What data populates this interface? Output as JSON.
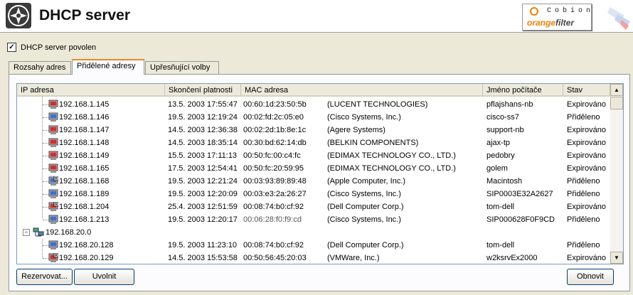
{
  "header": {
    "title": "DHCP server",
    "brand_top": "Cobion",
    "brand_bottom_a": "orange",
    "brand_bottom_b": "filter"
  },
  "enable": {
    "label": "DHCP server povolen",
    "checked": true
  },
  "tabs": [
    {
      "label": "Rozsahy adres",
      "active": false
    },
    {
      "label": "Přidělené adresy",
      "active": true
    },
    {
      "label": "Upřesňující volby",
      "active": false
    }
  ],
  "columns": [
    "IP adresa",
    "Skončení platnosti",
    "MAC adresa",
    "",
    "Jméno počítače",
    "Stav"
  ],
  "rows": [
    {
      "ip": "192.168.1.145",
      "expiry": "13.5. 2003 17:55:47",
      "mac": "00:60:1d:23:50:5b",
      "vendor": "(LUCENT TECHNOLOGIES)",
      "host": "pflajshans-nb",
      "status": "Expirováno",
      "icon": "red",
      "reserved": false
    },
    {
      "ip": "192.168.1.146",
      "expiry": "19.5. 2003 12:19:24",
      "mac": "00:02:fd:2c:05:e0",
      "vendor": "(Cisco Systems, Inc.)",
      "host": "cisco-ss7",
      "status": "Přiděleno",
      "icon": "blue",
      "reserved": false
    },
    {
      "ip": "192.168.1.147",
      "expiry": "14.5. 2003 12:36:38",
      "mac": "00:02:2d:1b:8e:1c",
      "vendor": "(Agere Systems)",
      "host": "support-nb",
      "status": "Expirováno",
      "icon": "red",
      "reserved": false
    },
    {
      "ip": "192.168.1.148",
      "expiry": "14.5. 2003 18:35:14",
      "mac": "00:30:bd:62:14:db",
      "vendor": "(BELKIN COMPONENTS)",
      "host": "ajax-tp",
      "status": "Expirováno",
      "icon": "red",
      "reserved": false
    },
    {
      "ip": "192.168.1.149",
      "expiry": "15.5. 2003 17:11:13",
      "mac": "00:50:fc:00:c4:fc",
      "vendor": "(EDIMAX TECHNOLOGY CO., LTD.)",
      "host": "pedobry",
      "status": "Expirováno",
      "icon": "red",
      "reserved": false
    },
    {
      "ip": "192.168.1.165",
      "expiry": "17.5. 2003 12:54:41",
      "mac": "00:50:fc:20:59:95",
      "vendor": "(EDIMAX TECHNOLOGY CO., LTD.)",
      "host": "golem",
      "status": "Expirováno",
      "icon": "red",
      "reserved": false
    },
    {
      "ip": "192.168.1.168",
      "expiry": "19.5. 2003 12:21:24",
      "mac": "00:03:93:89:89:48",
      "vendor": "(Apple Computer, Inc.)",
      "host": "Macintosh",
      "status": "Přiděleno",
      "icon": "blue",
      "reserved": true
    },
    {
      "ip": "192.168.1.189",
      "expiry": "19.5. 2003 12:20:09",
      "mac": "00:03:e3:2a:26:27",
      "vendor": "(Cisco Systems, Inc.)",
      "host": "SIP0003E32A2627",
      "status": "Přiděleno",
      "icon": "blue",
      "reserved": false
    },
    {
      "ip": "192.168.1.204",
      "expiry": "25.4. 2003 12:51:59",
      "mac": "00:08:74:b0:cf:92",
      "vendor": "(Dell Computer Corp.)",
      "host": "tom-dell",
      "status": "Expirováno",
      "icon": "red",
      "reserved": true
    },
    {
      "ip": "192.168.1.213",
      "expiry": "19.5. 2003 12:20:17",
      "mac": "00:06:28:f0:f9:cd",
      "vendor": "(Cisco Systems, Inc.)",
      "host": "SIP000628F0F9CD",
      "status": "Přiděleno",
      "icon": "blue",
      "reserved": false,
      "grey": true
    },
    {
      "ip": "192.168.20.0",
      "expiry": "",
      "mac": "",
      "vendor": "",
      "host": "",
      "status": "",
      "icon": "network",
      "reserved": false,
      "group": true
    },
    {
      "ip": "192.168.20.128",
      "expiry": "19.5. 2003 11:23:10",
      "mac": "00:08:74:b0:cf:92",
      "vendor": "(Dell Computer Corp.)",
      "host": "tom-dell",
      "status": "Přiděleno",
      "icon": "blue",
      "reserved": false
    },
    {
      "ip": "192.168.20.129",
      "expiry": "14.5. 2003 15:53:58",
      "mac": "00:50:56:45:20:03",
      "vendor": "(VMWare, Inc.)",
      "host": "w2ksrvEx2000",
      "status": "Expirováno",
      "icon": "red",
      "reserved": true
    }
  ],
  "buttons": {
    "reserve": "Rezervovat...",
    "release": "Uvolnit",
    "refresh": "Obnovit"
  },
  "colors": {
    "accent": "#e68b2c",
    "brand_orange": "#f08000",
    "list_border": "#7f9db9"
  }
}
